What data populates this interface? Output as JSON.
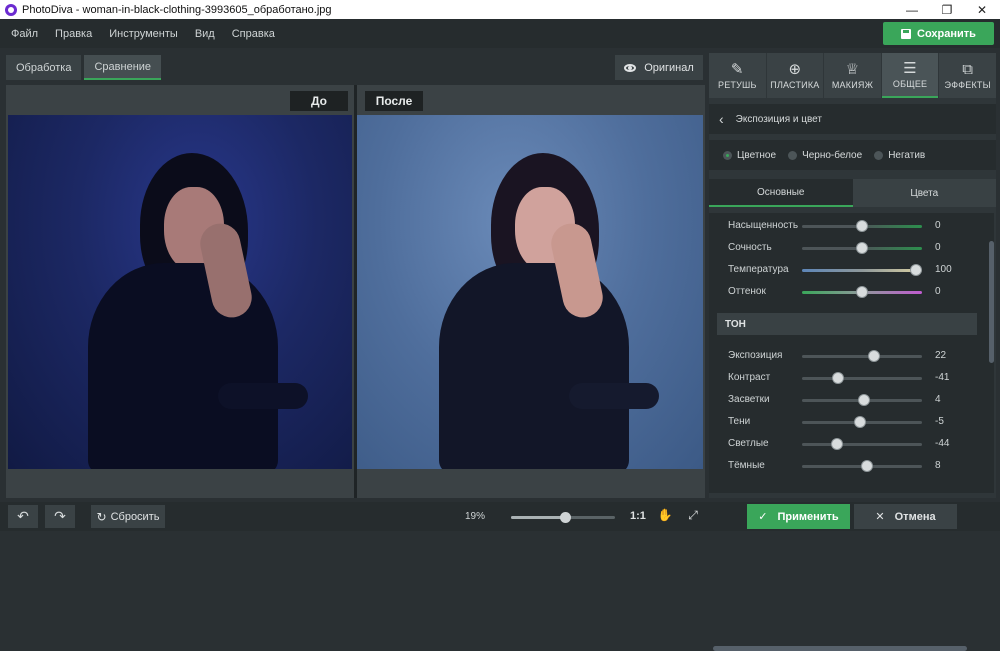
{
  "window": {
    "title": "PhotoDiva - woman-in-black-clothing-3993605_обработано.jpg",
    "controls": [
      "—",
      "❐",
      "✕"
    ]
  },
  "menu": [
    "Файл",
    "Правка",
    "Инструменты",
    "Вид",
    "Справка"
  ],
  "save_button": "Сохранить",
  "mode_tabs": [
    "Обработка",
    "Сравнение"
  ],
  "active_mode_tab": "Сравнение",
  "original_button": "Оригинал",
  "compare": {
    "before_label": "До",
    "after_label": "После"
  },
  "bottom": {
    "reset": "Сбросить",
    "zoom_percent": "19%",
    "zoom_level": 0.52,
    "zoom_one_to_one": "1:1",
    "apply": "Применить",
    "cancel": "Отмена"
  },
  "tools": [
    {
      "label": "РЕТУШЬ",
      "icon": "retouch-brush-icon",
      "glyph": "✎"
    },
    {
      "label": "ПЛАСТИКА",
      "icon": "liquify-crosshair-icon",
      "glyph": "⊕"
    },
    {
      "label": "МАКИЯЖ",
      "icon": "makeup-icon",
      "glyph": "♕"
    },
    {
      "label": "ОБЩЕЕ",
      "icon": "sliders-icon",
      "glyph": "☰"
    },
    {
      "label": "ЭФФЕКТЫ",
      "icon": "effects-icon",
      "glyph": "⧉"
    }
  ],
  "active_tool": "ОБЩЕЕ",
  "section_title": "Экспозиция и цвет",
  "color_modes": [
    {
      "label": "Цветное",
      "selected": true
    },
    {
      "label": "Черно-белое",
      "selected": false
    },
    {
      "label": "Негатив",
      "selected": false
    }
  ],
  "subtabs": [
    "Основные",
    "Цвета"
  ],
  "active_subtab": "Основные",
  "color_sliders": [
    {
      "label": "Насыщенность",
      "value": "0",
      "level": 0.5,
      "track": "linear-gradient(90deg,#4d5558,#4d5558 50%,#2c8f4d 100%)"
    },
    {
      "label": "Сочность",
      "value": "0",
      "level": 0.5,
      "track": "linear-gradient(90deg,#4d5558,#4d5558 50%,#2c8f4d 100%)"
    },
    {
      "label": "Температура",
      "value": "100",
      "level": 0.95,
      "track": "linear-gradient(90deg,#5d86b8,#8f999b 50%,#d9d0a2 100%)"
    },
    {
      "label": "Оттенок",
      "value": "0",
      "level": 0.5,
      "track": "linear-gradient(90deg,#3aa65a,#8f999b 50%,#c05bd0 100%)"
    }
  ],
  "tone_header": "ТОН",
  "tone_sliders": [
    {
      "label": "Экспозиция",
      "value": "22",
      "level": 0.6
    },
    {
      "label": "Контраст",
      "value": "-41",
      "level": 0.3
    },
    {
      "label": "Засветки",
      "value": "4",
      "level": 0.52
    },
    {
      "label": "Тени",
      "value": "-5",
      "level": 0.48
    },
    {
      "label": "Светлые",
      "value": "-44",
      "level": 0.29
    },
    {
      "label": "Тёмные",
      "value": "8",
      "level": 0.54
    }
  ],
  "colors": {
    "accent": "#3aa65a",
    "panel": "#2f3639",
    "dark": "#262c2e"
  }
}
